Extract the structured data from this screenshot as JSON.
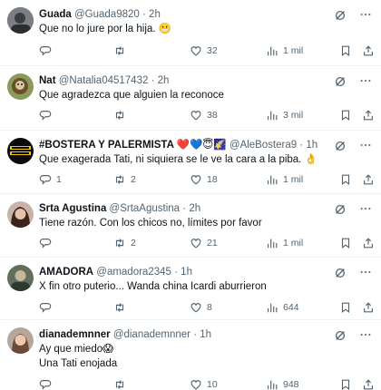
{
  "posts": [
    {
      "name": "Guada",
      "handle": "@Guada9820",
      "sep": "·",
      "time": "2h",
      "text": "Que no lo jure por la hija. 😬",
      "replies": "",
      "retweets": "",
      "likes": "32",
      "views": "1 mil"
    },
    {
      "name": "Nat",
      "handle": "@Natalia04517432",
      "sep": "·",
      "time": "2h",
      "text": "Que agradezca que alguien la reconoce",
      "replies": "",
      "retweets": "",
      "likes": "38",
      "views": "3 mil"
    },
    {
      "name": "#BOSTERA Y PALERMISTA ❤️💙😇🌠",
      "handle": "@AleBostera9",
      "sep": "·",
      "time": "1h",
      "text": "Que exagerada Tati, ni siquiera se le ve la cara a la piba. 👌",
      "replies": "1",
      "retweets": "2",
      "likes": "18",
      "views": "1 mil"
    },
    {
      "name": "Srta Agustina",
      "handle": "@SrtaAgustina",
      "sep": "·",
      "time": "2h",
      "text": "Tiene razón. Con los chicos no, límites por favor",
      "replies": "",
      "retweets": "2",
      "likes": "21",
      "views": "1 mil"
    },
    {
      "name": "AMADORA",
      "handle": "@amadora2345",
      "sep": "·",
      "time": "1h",
      "text": "X fin otro puterio... Wanda china Icardi aburrieron",
      "replies": "",
      "retweets": "",
      "likes": "8",
      "views": "644"
    },
    {
      "name": "dianademnner",
      "handle": "@dianademnner",
      "sep": "·",
      "time": "1h",
      "text": "Ay que miedo😱",
      "text2": "Una Tati enojada",
      "replies": "",
      "retweets": "",
      "likes": "10",
      "views": "948"
    }
  ],
  "icons": {
    "grok": "grok-icon",
    "more": "more-icon",
    "reply": "reply-icon",
    "retweet": "retweet-icon",
    "like": "like-icon",
    "views": "views-icon",
    "bookmark": "bookmark-icon",
    "share": "share-icon"
  },
  "colors": {
    "text": "#0f1419",
    "secondary": "#536471",
    "divider": "#eff3f4"
  }
}
